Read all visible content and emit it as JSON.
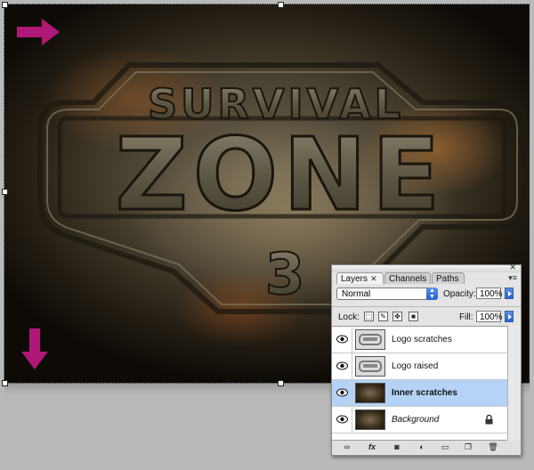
{
  "artwork": {
    "title_line1": "SURVIVAL",
    "title_line2": "ZONE",
    "title_line3": "3"
  },
  "layers_panel": {
    "tabs": [
      {
        "label": "Layers",
        "active": true
      },
      {
        "label": "Channels",
        "active": false
      },
      {
        "label": "Paths",
        "active": false
      }
    ],
    "blend_mode": "Normal",
    "opacity_label": "Opacity:",
    "opacity_value": "100%",
    "lock_label": "Lock:",
    "fill_label": "Fill:",
    "fill_value": "100%",
    "layers": [
      {
        "name": "Logo scratches",
        "visible": true,
        "selected": false,
        "locked": false
      },
      {
        "name": "Logo raised",
        "visible": true,
        "selected": false,
        "locked": false
      },
      {
        "name": "Inner scratches",
        "visible": true,
        "selected": true,
        "locked": false
      },
      {
        "name": "Background",
        "visible": true,
        "selected": false,
        "locked": true
      }
    ],
    "bottom_icons": [
      "link-icon",
      "fx-icon",
      "mask-icon",
      "adjustment-icon",
      "folder-icon",
      "new-layer-icon",
      "trash-icon"
    ]
  },
  "colors": {
    "arrow": "#b01878",
    "selection": "#b5d3f7"
  }
}
